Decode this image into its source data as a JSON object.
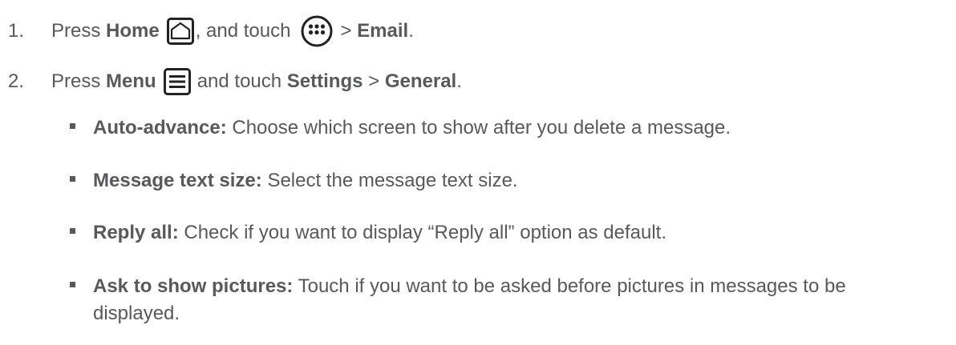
{
  "steps": [
    {
      "number": "1.",
      "press": "Press",
      "home_label": "Home",
      "home_icon": "home-icon",
      "mid": ", and touch",
      "apps_icon": "apps-icon",
      "sep": ">",
      "target": "Email",
      "end": "."
    },
    {
      "number": "2.",
      "press": "Press",
      "menu_label": "Menu",
      "menu_icon": "menu-icon",
      "mid": "and touch",
      "settings": "Settings",
      "sep": ">",
      "general": "General",
      "end": "."
    }
  ],
  "options": [
    {
      "term": "Auto-advance:",
      "desc": "Choose which screen to show after you delete a message."
    },
    {
      "term": "Message text size:",
      "desc": "Select the message text size."
    },
    {
      "term": "Reply all:",
      "desc": "Check if you want to display “Reply all” option as default."
    },
    {
      "term": "Ask to show pictures:",
      "desc": "Touch if you want to be asked before pictures in messages to be displayed."
    }
  ],
  "colors": {
    "text": "#58595b",
    "icon": "#222222"
  }
}
